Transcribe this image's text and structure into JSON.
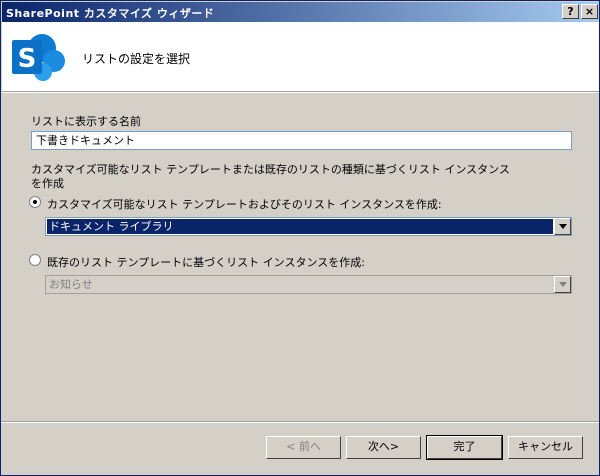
{
  "window": {
    "title": "SharePoint カスタマイズ ウィザード",
    "help_label": "?",
    "close_label": "×"
  },
  "header": {
    "title": "リストの設定を選択",
    "logo_letter": "S"
  },
  "form": {
    "name_label": "リストに表示する名前",
    "name_value": "下書きドキュメント",
    "instruction_line1": "カスタマイズ可能なリスト テンプレートまたは既存のリストの種類に基づくリスト インスタンス",
    "instruction_line2": "を作成",
    "option_custom": {
      "label": "カスタマイズ可能なリスト テンプレートおよびそのリスト インスタンスを作成:",
      "selected": true,
      "select_value": "ドキュメント ライブラリ"
    },
    "option_existing": {
      "label": "既存のリスト テンプレートに基づくリスト インスタンスを作成:",
      "selected": false,
      "select_value": "お知らせ"
    }
  },
  "buttons": {
    "back": "< 前へ",
    "next": "次へ>",
    "finish": "完了",
    "cancel": "キャンセル"
  },
  "colors": {
    "titlebar_start": "#0a246a",
    "titlebar_end": "#a6caf0",
    "logo_blue": "#0b71c7"
  }
}
